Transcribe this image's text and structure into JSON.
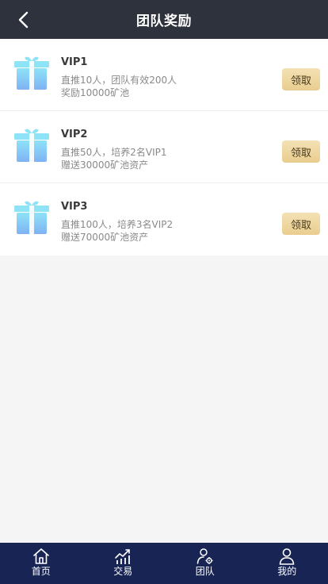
{
  "header": {
    "title": "团队奖励",
    "back_icon": "chevron-left-icon"
  },
  "colors": {
    "header_bg": "#2e323d",
    "tabbar_bg": "#172454",
    "claim_button_bg": "#ecd49c",
    "page_bg": "#f5f5f5",
    "gift_icon": "#8fd6f6"
  },
  "rewards": [
    {
      "name": "VIP1",
      "line1": "直推10人，团队有效200人",
      "line2": "奖励10000矿池",
      "claim_label": "领取",
      "icon": "gift-icon"
    },
    {
      "name": "VIP2",
      "line1": "直推50人，培养2名VIP1",
      "line2": "赠送30000矿池资产",
      "claim_label": "领取",
      "icon": "gift-icon"
    },
    {
      "name": "VIP3",
      "line1": "直推100人，培养3名VIP2",
      "line2": "赠送70000矿池资产",
      "claim_label": "领取",
      "icon": "gift-icon"
    }
  ],
  "tabbar": {
    "items": [
      {
        "label": "首页",
        "icon": "home-icon"
      },
      {
        "label": "交易",
        "icon": "trade-chart-icon"
      },
      {
        "label": "团队",
        "icon": "team-icon"
      },
      {
        "label": "我的",
        "icon": "user-icon"
      }
    ]
  }
}
